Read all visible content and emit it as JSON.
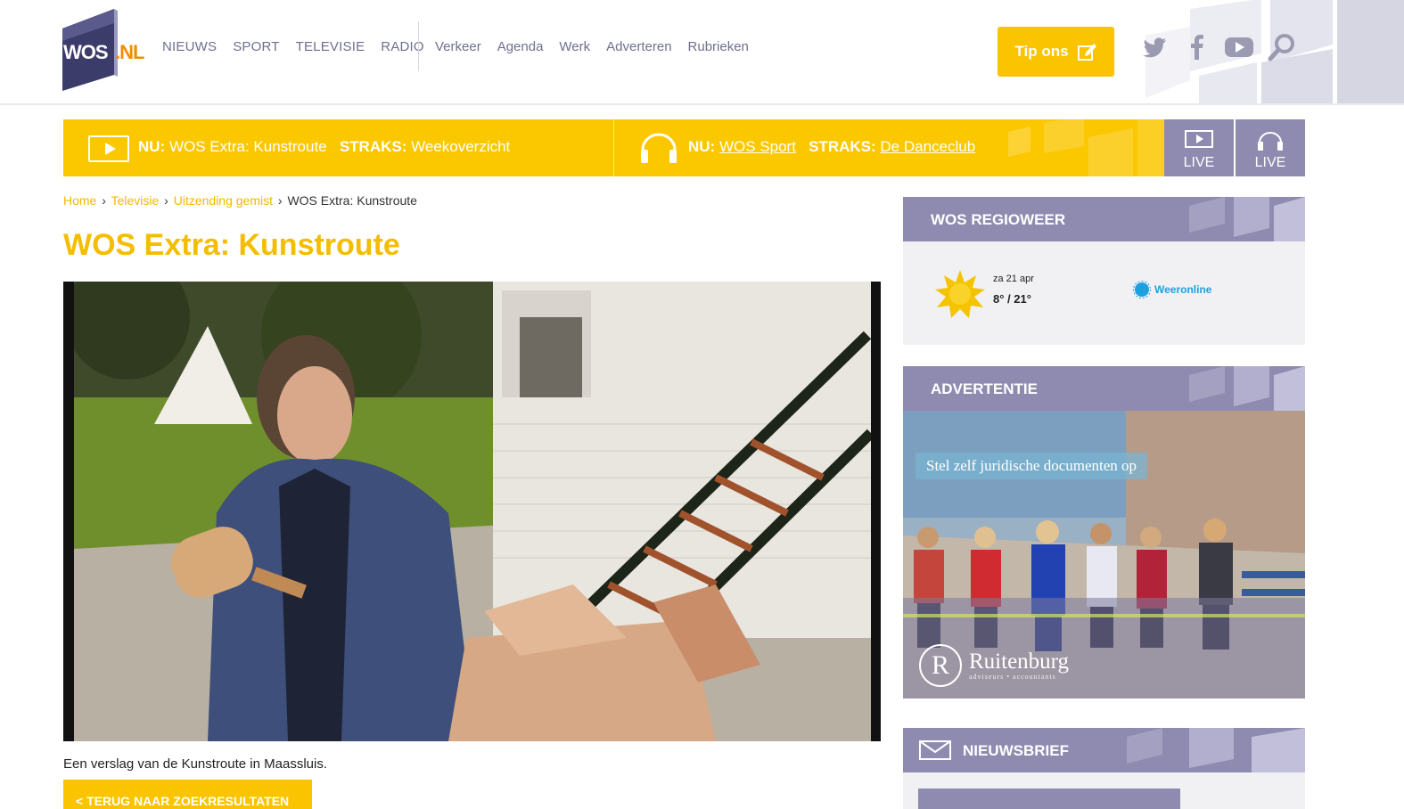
{
  "header": {
    "logo": {
      "wos": "WOS",
      "nl": ".NL"
    },
    "nav_main": [
      "NIEUWS",
      "SPORT",
      "TELEVISIE",
      "RADIO"
    ],
    "nav_sub": [
      "Verkeer",
      "Agenda",
      "Werk",
      "Adverteren",
      "Rubrieken"
    ],
    "tip_label": "Tip ons",
    "social_icons": [
      "twitter-icon",
      "facebook-icon",
      "youtube-icon",
      "search-icon"
    ]
  },
  "livebar": {
    "tv": {
      "nu_label": "NU:",
      "nu_value": "WOS Extra: Kunstroute",
      "straks_label": "STRAKS:",
      "straks_value": "Weekoverzicht"
    },
    "radio": {
      "nu_label": "NU:",
      "nu_value": "WOS Sport",
      "straks_label": "STRAKS:",
      "straks_value": "De Danceclub"
    },
    "live_tv_label": "LIVE",
    "live_radio_label": "LIVE"
  },
  "breadcrumb": {
    "items": [
      "Home",
      "Televisie",
      "Uitzending gemist"
    ],
    "current": "WOS Extra: Kunstroute",
    "separator": "›"
  },
  "article": {
    "title": "WOS Extra: Kunstroute",
    "caption": "Een verslag van de Kunstroute in Maassluis.",
    "back_label": "< Terug naar zoekresultaten"
  },
  "sidebar": {
    "weather": {
      "heading": "WOS REGIOWEER",
      "date": "za 21 apr",
      "temp": "8° / 21°",
      "provider": "Weeronline"
    },
    "ad": {
      "heading": "ADVERTENTIE",
      "tagline": "Stel zelf juridische documenten op",
      "brand": "Ruitenburg",
      "brand_sub": "adviseurs • accountants"
    },
    "newsletter": {
      "heading": "NIEUWSBRIEF"
    }
  },
  "colors": {
    "brand_yellow": "#fbc400",
    "brand_purple": "#8f8bb0",
    "title_yellow": "#f5bd00",
    "nav_text": "#6f6f8f"
  }
}
